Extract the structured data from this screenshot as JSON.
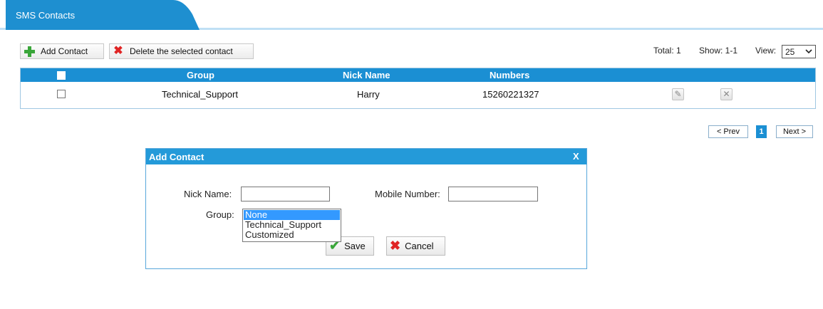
{
  "tab": {
    "label": "SMS Contacts"
  },
  "toolbar": {
    "add_label": "Add Contact",
    "delete_label": "Delete the selected contact",
    "add_icon": "plus-icon",
    "delete_icon": "red-x-icon"
  },
  "pager": {
    "total": "Total: 1",
    "show": "Show: 1-1",
    "view_label": "View:",
    "view_value": "25",
    "prev_label": "< Prev",
    "current_page": "1",
    "next_label": "Next >"
  },
  "table": {
    "columns": [
      "Group",
      "Nick Name",
      "Numbers"
    ],
    "rows": [
      {
        "group": "Technical_Support",
        "nick_name": "Harry",
        "numbers": "15260221327"
      }
    ]
  },
  "dialog": {
    "title": "Add Contact",
    "close_label": "X",
    "nick_name_label": "Nick Name:",
    "nick_name_value": "",
    "mobile_label": "Mobile Number:",
    "mobile_value": "",
    "group_label": "Group:",
    "group_options": [
      "None",
      "Technical_Support",
      "Customized"
    ],
    "group_selected": "None",
    "save_label": "Save",
    "cancel_label": "Cancel"
  },
  "colors": {
    "header_blue": "#1b8fd3",
    "tab_blue": "#1e8fd0",
    "add_green": "#3aa63a",
    "delete_red": "#e02424"
  }
}
